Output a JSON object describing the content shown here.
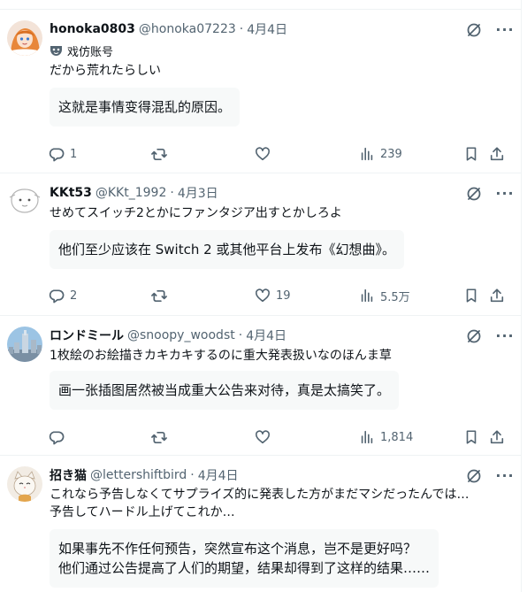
{
  "posts": [
    {
      "name": "honoka0803",
      "handle": "@honoka07223",
      "sep": "·",
      "date": "4月4日",
      "badge": "戏仿账号",
      "text": [
        "だから荒れたらしい"
      ],
      "translation": [
        "这就是事情变得混乱的原因。"
      ],
      "counts": {
        "reply": "1",
        "repost": "",
        "like": "",
        "views": "239"
      }
    },
    {
      "name": "KKt53",
      "handle": "@KKt_1992",
      "sep": "·",
      "date": "4月3日",
      "text": [
        "せめてスイッチ2とかにファンタジア出すとかしろよ"
      ],
      "translation": [
        "他们至少应该在 Switch 2 或其他平台上发布《幻想曲》。"
      ],
      "counts": {
        "reply": "2",
        "repost": "",
        "like": "19",
        "views": "5.5万"
      }
    },
    {
      "name": "ロンドミール",
      "handle": "@snoopy_woodst",
      "sep": "·",
      "date": "4月4日",
      "text": [
        "1枚絵のお絵描きカキカキするのに重大発表扱いなのほんま草"
      ],
      "translation": [
        "画一张插图居然被当成重大公告来对待，真是太搞笑了。"
      ],
      "counts": {
        "reply": "",
        "repost": "",
        "like": "",
        "views": "1,814"
      }
    },
    {
      "name": "招き猫",
      "handle": "@lettershiftbird",
      "sep": "·",
      "date": "4月4日",
      "text": [
        "これなら予告しなくてサプライズ的に発表した方がまだマシだったんでは…",
        "予告してハードル上げてこれか…"
      ],
      "translation": [
        "如果事先不作任何预告，突然宣布这个消息，岂不是更好吗？",
        "他们通过公告提高了人们的期望，结果却得到了这样的结果……"
      ],
      "counts": {}
    }
  ],
  "icons": {
    "avatar": "avatar-image",
    "grok": "grok-icon",
    "more": "more-icon",
    "reply": "reply-icon",
    "repost": "repost-icon",
    "like": "like-icon",
    "views": "views-icon",
    "bookmark": "bookmark-icon",
    "share": "share-icon",
    "parody": "parody-mask-icon"
  },
  "more_glyph": "···",
  "colors": {
    "text": "#0f1419",
    "secondary": "#536471",
    "translation_bg": "#f7f9f9",
    "border": "#eff3f4"
  }
}
